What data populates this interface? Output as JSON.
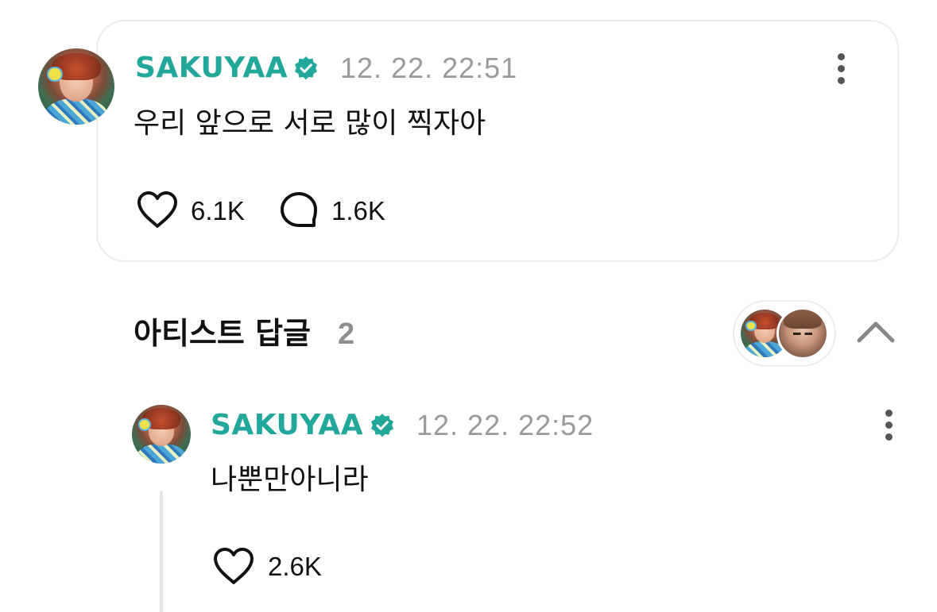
{
  "post": {
    "username": "SAKUYAA",
    "timestamp": "12. 22. 22:51",
    "text": "우리 앞으로 서로 많이 찍자아",
    "likes": "6.1K",
    "comments": "1.6K"
  },
  "artist_replies": {
    "title": "아티스트 답글",
    "count": "2"
  },
  "reply": {
    "username": "SAKUYAA",
    "timestamp": "12. 22. 22:52",
    "text": "나뿐만아니라",
    "likes": "2.6K"
  },
  "colors": {
    "accent": "#22a79b",
    "muted": "#9a9a9a",
    "border": "#ececec"
  },
  "icons": [
    "verified-badge-icon",
    "more-vertical-icon",
    "heart-icon",
    "comment-icon",
    "chevron-up-icon"
  ]
}
